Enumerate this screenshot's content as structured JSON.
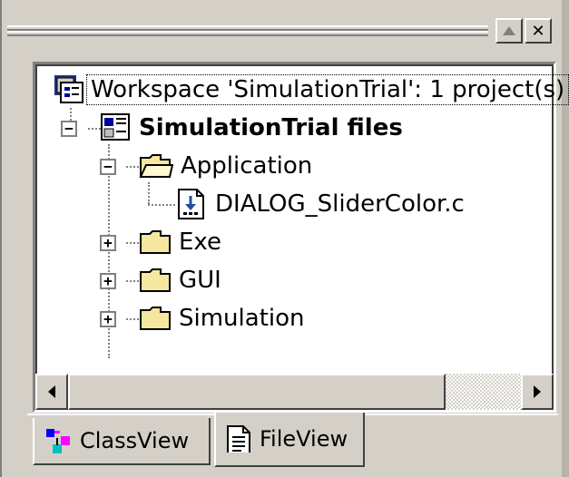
{
  "window": {
    "restore_glyph": "▲",
    "close_glyph": "✕"
  },
  "tree": {
    "workspace_label": "Workspace 'SimulationTrial': 1 project(s)",
    "project_label": "SimulationTrial files",
    "items": [
      {
        "label": "Application",
        "expander": "−",
        "icon": "folder-open-icon"
      },
      {
        "label": "DIALOG_SliderColor.c",
        "icon": "c-source-file-icon"
      },
      {
        "label": "Exe",
        "expander": "+",
        "icon": "folder-icon"
      },
      {
        "label": "GUI",
        "expander": "+",
        "icon": "folder-icon"
      },
      {
        "label": "Simulation",
        "expander": "+",
        "icon": "folder-icon"
      }
    ],
    "project_expander": "−"
  },
  "tabs": [
    {
      "label": "ClassView",
      "icon": "classview-icon",
      "active": false
    },
    {
      "label": "FileView",
      "icon": "fileview-icon",
      "active": true
    }
  ],
  "colors": {
    "face": "#d4d0c8",
    "shadow": "#808080",
    "folder": "#f5e6a0"
  }
}
